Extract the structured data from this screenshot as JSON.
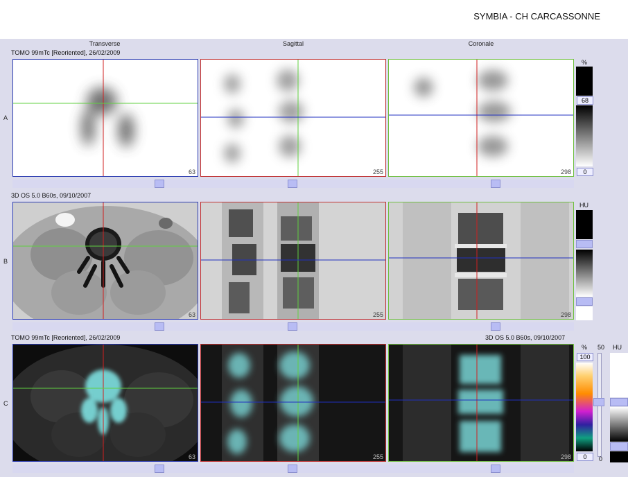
{
  "header": {
    "brand": "SYMBIA - CH CARCASSONNE"
  },
  "columns": {
    "transverse": "Transverse",
    "sagittal": "Sagittal",
    "coronal": "Coronale"
  },
  "rows": {
    "a": {
      "label": "A",
      "series_left": "TOMO 99mTc [Reoriented], 26/02/2009"
    },
    "b": {
      "label": "B",
      "series_left": "3D  OS  5.0  B60s, 09/10/2007"
    },
    "c": {
      "label": "C",
      "series_left": "TOMO 99mTc [Reoriented], 26/02/2009",
      "series_right": "3D  OS  5.0  B60s, 09/10/2007"
    }
  },
  "slice_numbers": {
    "transverse": "63",
    "sagittal": "255",
    "coronal": "298"
  },
  "colorbars": {
    "a": {
      "unit": "%",
      "top_value": "68",
      "bottom_value": "0"
    },
    "b": {
      "unit": "HU"
    },
    "c": {
      "unit_pct": "%",
      "unit_hu": "HU",
      "top_value": "100",
      "bottom_value": "0",
      "mid_label": "50",
      "bottom_small": "0"
    }
  },
  "colors": {
    "transverse_border": "#2a3ab0",
    "sagittal_border": "#c03030",
    "coronal_border": "#70c040",
    "crosshair_red": "#d02020",
    "crosshair_green": "#60d040",
    "crosshair_blue": "#2030c0",
    "fused_tint": "#7ee0e0"
  }
}
